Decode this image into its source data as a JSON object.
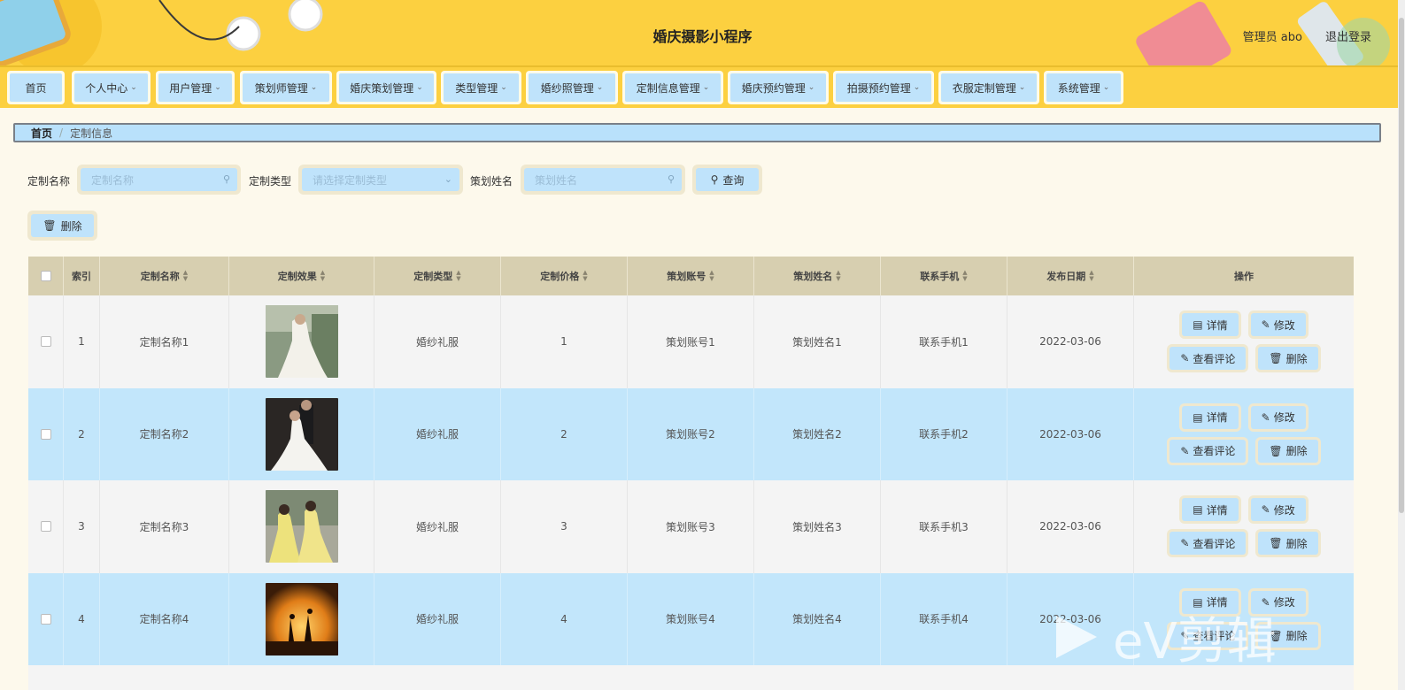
{
  "header": {
    "title": "婚庆摄影小程序",
    "user_label": "管理员 abo",
    "logout_label": "退出登录"
  },
  "nav": [
    {
      "label": "首页",
      "has_dropdown": false
    },
    {
      "label": "个人中心",
      "has_dropdown": true
    },
    {
      "label": "用户管理",
      "has_dropdown": true
    },
    {
      "label": "策划师管理",
      "has_dropdown": true
    },
    {
      "label": "婚庆策划管理",
      "has_dropdown": true
    },
    {
      "label": "类型管理",
      "has_dropdown": true
    },
    {
      "label": "婚纱照管理",
      "has_dropdown": true
    },
    {
      "label": "定制信息管理",
      "has_dropdown": true
    },
    {
      "label": "婚庆预约管理",
      "has_dropdown": true
    },
    {
      "label": "拍摄预约管理",
      "has_dropdown": true
    },
    {
      "label": "衣服定制管理",
      "has_dropdown": true
    },
    {
      "label": "系统管理",
      "has_dropdown": true
    }
  ],
  "breadcrumb": {
    "home": "首页",
    "current": "定制信息"
  },
  "search": {
    "name_label": "定制名称",
    "name_placeholder": "定制名称",
    "type_label": "定制类型",
    "type_placeholder": "请选择定制类型",
    "planner_label": "策划姓名",
    "planner_placeholder": "策划姓名",
    "query_label": "查询"
  },
  "toolbar": {
    "delete_label": "删除"
  },
  "table": {
    "headers": [
      "索引",
      "定制名称",
      "定制效果",
      "定制类型",
      "定制价格",
      "策划账号",
      "策划姓名",
      "联系手机",
      "发布日期",
      "操作"
    ],
    "rows": [
      {
        "index": "1",
        "name": "定制名称1",
        "type": "婚纱礼服",
        "price": "1",
        "account": "策划账号1",
        "planner": "策划姓名1",
        "phone": "联系手机1",
        "date": "2022-03-06"
      },
      {
        "index": "2",
        "name": "定制名称2",
        "type": "婚纱礼服",
        "price": "2",
        "account": "策划账号2",
        "planner": "策划姓名2",
        "phone": "联系手机2",
        "date": "2022-03-06"
      },
      {
        "index": "3",
        "name": "定制名称3",
        "type": "婚纱礼服",
        "price": "3",
        "account": "策划账号3",
        "planner": "策划姓名3",
        "phone": "联系手机3",
        "date": "2022-03-06"
      },
      {
        "index": "4",
        "name": "定制名称4",
        "type": "婚纱礼服",
        "price": "4",
        "account": "策划账号4",
        "planner": "策划姓名4",
        "phone": "联系手机4",
        "date": "2022-03-06"
      }
    ],
    "actions": {
      "detail": "详情",
      "edit": "修改",
      "comments": "查看评论",
      "delete": "删除"
    }
  },
  "watermark": {
    "text": "eV剪辑"
  },
  "colors": {
    "header_bg": "#fcd040",
    "button_bg": "#bfe3fb",
    "button_border": "#efe8cf",
    "table_header_bg": "#d7cfb0",
    "row_highlight": "#c2e6fb",
    "page_bg": "#fdf9ec"
  }
}
